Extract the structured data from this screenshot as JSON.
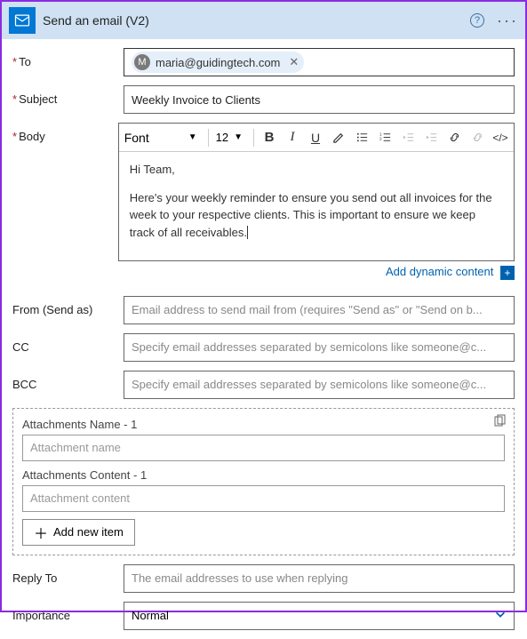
{
  "header": {
    "title": "Send an email (V2)"
  },
  "to": {
    "label": "To",
    "chip": {
      "initial": "M",
      "email": "maria@guidingtech.com"
    }
  },
  "subject": {
    "label": "Subject",
    "value": "Weekly Invoice to Clients"
  },
  "body": {
    "label": "Body",
    "font": "Font",
    "size": "12",
    "p1": "Hi Team,",
    "p2": "Here's your weekly reminder to ensure you send out all invoices for the week to your respective clients. This is important to ensure we keep track of all receivables."
  },
  "dynamic": {
    "label": "Add dynamic content"
  },
  "from": {
    "label": "From (Send as)",
    "placeholder": "Email address to send mail from (requires \"Send as\" or \"Send on b..."
  },
  "cc": {
    "label": "CC",
    "placeholder": "Specify email addresses separated by semicolons like someone@c..."
  },
  "bcc": {
    "label": "BCC",
    "placeholder": "Specify email addresses separated by semicolons like someone@c..."
  },
  "attachments": {
    "name_label": "Attachments Name - 1",
    "name_placeholder": "Attachment name",
    "content_label": "Attachments Content - 1",
    "content_placeholder": "Attachment content",
    "add_label": "Add new item"
  },
  "replyto": {
    "label": "Reply To",
    "placeholder": "The email addresses to use when replying"
  },
  "importance": {
    "label": "Importance",
    "value": "Normal"
  }
}
